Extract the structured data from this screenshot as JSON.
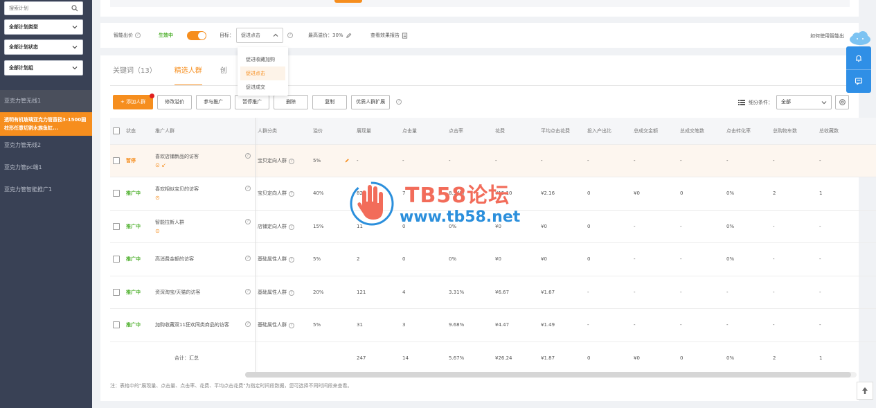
{
  "sidebar": {
    "search_placeholder": "搜索计划",
    "plan_type": "全部计划类型",
    "plan_status": "全部计划状态",
    "plan_group": "全部计划组",
    "items": [
      {
        "label": "亚克力管无线1"
      },
      {
        "label": "透明有机玻璃亚克力管直径3-1500圆柱形任意切割水族鱼缸..."
      },
      {
        "label": "亚克力管无线2"
      },
      {
        "label": "亚克力管pc端1"
      },
      {
        "label": "亚克力管智能推广1"
      }
    ]
  },
  "bid_bar": {
    "smart_bid_label": "智能出价",
    "status": "生效中",
    "goal_label": "目标：",
    "goal_value": "促进点击",
    "max_premium": "最高溢价：30%",
    "report_link": "查看效果报告",
    "help_link": "如何使用智能出",
    "goal_options": [
      "促进收藏加购",
      "促进点击",
      "促进成交"
    ]
  },
  "tabs": [
    "关键词（13）",
    "精选人群",
    "创"
  ],
  "toolbar": {
    "add_audience": "+ 添加人群",
    "modify_premium": "修改溢价",
    "join_promo": "参与推广",
    "pause_promo": "暂停推广",
    "delete": "删除",
    "copy": "复制",
    "quality_expand": "优质人群扩展",
    "filter_label": "细分条件：",
    "filter_value": "全部"
  },
  "table": {
    "headers": [
      "状态",
      "推广人群",
      "人群分类",
      "溢价",
      "展现量",
      "点击量",
      "点击率",
      "花费",
      "平均点击花费",
      "投入产出比",
      "总成交金额",
      "总成交笔数",
      "点击转化率",
      "总购物车数",
      "总收藏数"
    ],
    "rows": [
      {
        "status": "暂停",
        "status_type": "pause",
        "name": "喜欢店铺新品的访客",
        "category": "宝贝定向人群",
        "premium": "5%",
        "impressions": "-",
        "clicks": "-",
        "ctr": "-",
        "cost": "-",
        "avg_cpc": "-",
        "roi": "-",
        "gmv": "-",
        "orders": "-",
        "cvr": "-",
        "carts": "-",
        "favs": "-"
      },
      {
        "status": "推广中",
        "status_type": "run",
        "name": "喜欢相似宝贝的访客",
        "category": "宝贝定向人群",
        "premium": "40%",
        "impressions": "82",
        "clicks": "7",
        "ctr": "8.54%",
        "cost": "¥15.10",
        "avg_cpc": "¥2.16",
        "roi": "0",
        "gmv": "¥0",
        "orders": "0",
        "cvr": "0%",
        "carts": "2",
        "favs": "1"
      },
      {
        "status": "推广中",
        "status_type": "run",
        "name": "智能拉新人群",
        "category": "店铺定向人群",
        "premium": "15%",
        "impressions": "11",
        "clicks": "0",
        "ctr": "0%",
        "cost": "¥0",
        "avg_cpc": "¥0",
        "roi": "0",
        "gmv": "-",
        "orders": "-",
        "cvr": "0%",
        "carts": "-",
        "favs": "-"
      },
      {
        "status": "推广中",
        "status_type": "run",
        "name": "高消费金额的访客",
        "category": "基础属性人群",
        "premium": "5%",
        "impressions": "2",
        "clicks": "0",
        "ctr": "0%",
        "cost": "¥0",
        "avg_cpc": "¥0",
        "roi": "0",
        "gmv": "-",
        "orders": "-",
        "cvr": "0%",
        "carts": "-",
        "favs": "-"
      },
      {
        "status": "推广中",
        "status_type": "run",
        "name": "资深淘宝/天猫的访客",
        "category": "基础属性人群",
        "premium": "20%",
        "impressions": "121",
        "clicks": "4",
        "ctr": "3.31%",
        "cost": "¥6.67",
        "avg_cpc": "¥1.67",
        "roi": "-",
        "gmv": "-",
        "orders": "-",
        "cvr": "-",
        "carts": "-",
        "favs": "-"
      },
      {
        "status": "推广中",
        "status_type": "run",
        "name": "加购收藏双11狂欢同类商品的访客",
        "category": "基础属性人群",
        "premium": "5%",
        "impressions": "31",
        "clicks": "3",
        "ctr": "9.68%",
        "cost": "¥4.47",
        "avg_cpc": "¥1.49",
        "roi": "-",
        "gmv": "-",
        "orders": "-",
        "cvr": "-",
        "carts": "-",
        "favs": "-"
      }
    ],
    "total": {
      "label": "合计：汇总",
      "impressions": "247",
      "clicks": "14",
      "ctr": "5.67%",
      "cost": "¥26.24",
      "avg_cpc": "¥1.87",
      "roi": "0",
      "gmv": "¥0",
      "orders": "0",
      "cvr": "0%",
      "carts": "2",
      "favs": "1"
    }
  },
  "note": "注：表格中的\"展现量、点击量、点击率、花费、平均点击花费\"为指定时间段数据，您可选择不同时间段来查看。",
  "watermark": {
    "title": "TB58论坛",
    "url": "www.tb58.net"
  },
  "colors": {
    "accent": "#f68e1e",
    "sidebar": "#394155",
    "running": "#4caf2a",
    "float_bar": "#2f8fe6"
  }
}
